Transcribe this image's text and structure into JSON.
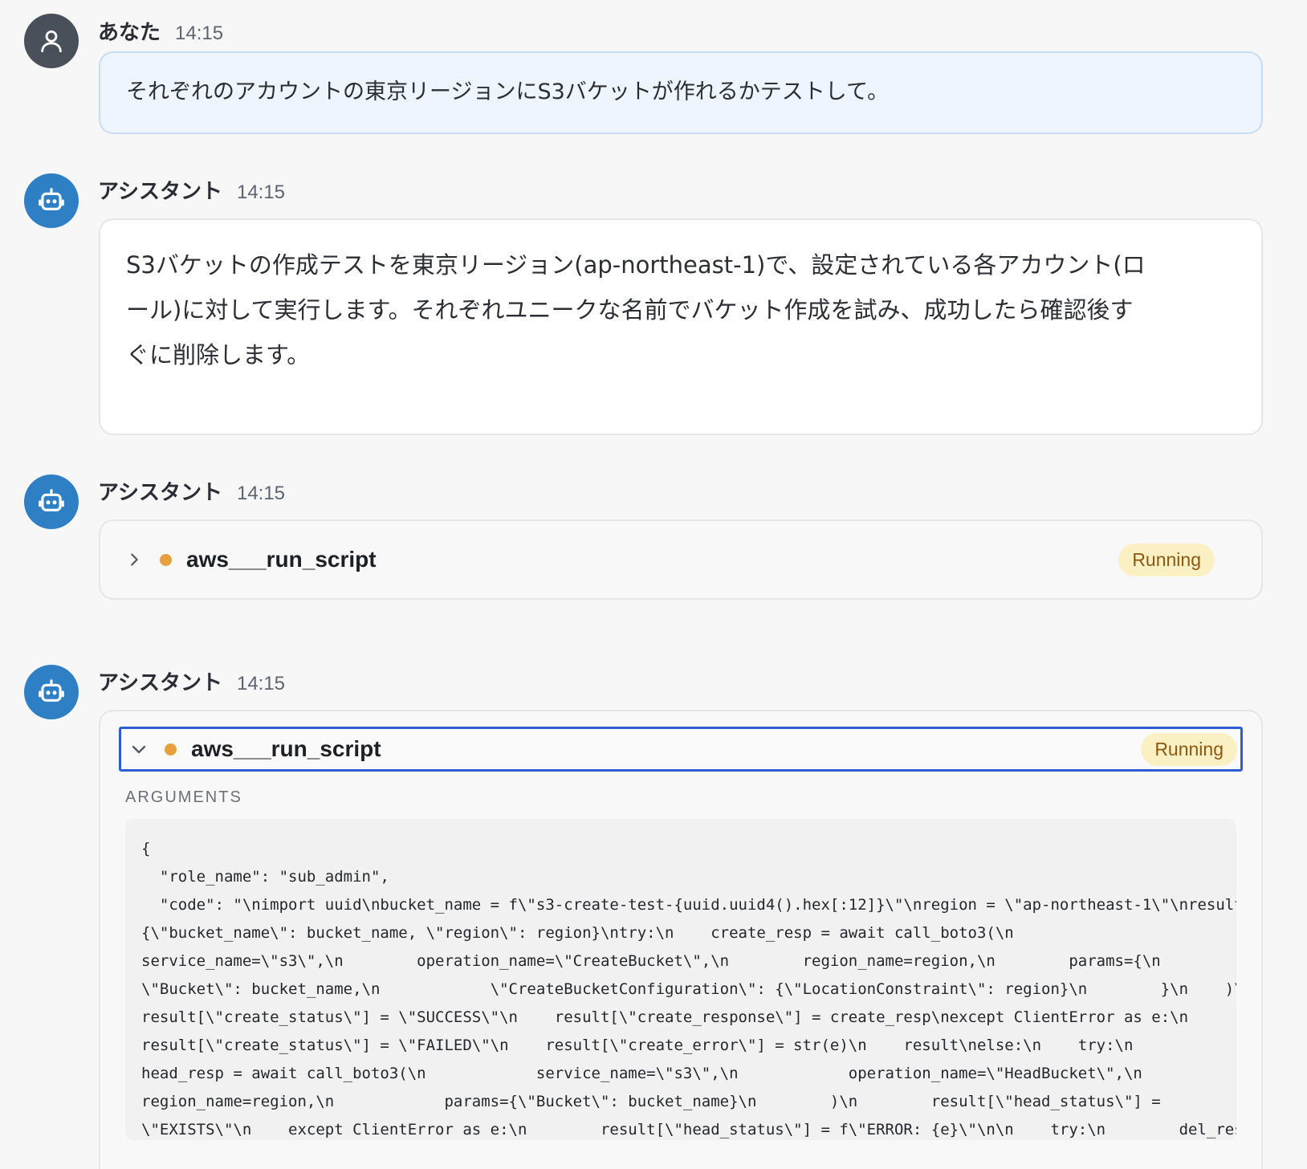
{
  "messages": [
    {
      "role": "user",
      "author": "あなた",
      "time": "14:15",
      "text": "それぞれのアカウントの東京リージョンにS3バケットが作れるかテストして。"
    },
    {
      "role": "assistant",
      "author": "アシスタント",
      "time": "14:15",
      "text_lines": [
        "S3バケットの作成テストを東京リージョン(ap-northeast-1)で、設定されている各アカウント(ロ",
        "ール)に対して実行します。それぞれユニークな名前でバケット作成を試み、成功したら確認後す",
        "ぐに削除します。"
      ]
    },
    {
      "role": "assistant",
      "author": "アシスタント",
      "time": "14:15",
      "tool": {
        "name": "aws___run_script",
        "status": "Running",
        "expanded": false
      }
    },
    {
      "role": "assistant",
      "author": "アシスタント",
      "time": "14:15",
      "tool": {
        "name": "aws___run_script",
        "status": "Running",
        "expanded": true,
        "arguments_label": "ARGUMENTS",
        "arguments_lines": [
          "{",
          "  \"role_name\": \"sub_admin\",",
          "  \"code\": \"\\nimport uuid\\nbucket_name = f\\\"s3-create-test-{uuid.uuid4().hex[:12]}\\\"\\nregion = \\\"ap-northeast-1\\\"\\nresult =",
          "{\\\"bucket_name\\\": bucket_name, \\\"region\\\": region}\\ntry:\\n    create_resp = await call_boto3(\\n",
          "service_name=\\\"s3\\\",\\n        operation_name=\\\"CreateBucket\\\",\\n        region_name=region,\\n        params={\\n",
          "\\\"Bucket\\\": bucket_name,\\n            \\\"CreateBucketConfiguration\\\": {\\\"LocationConstraint\\\": region}\\n        }\\n    )\\n",
          "result[\\\"create_status\\\"] = \\\"SUCCESS\\\"\\n    result[\\\"create_response\\\"] = create_resp\\nexcept ClientError as e:\\n",
          "result[\\\"create_status\\\"] = \\\"FAILED\\\"\\n    result[\\\"create_error\\\"] = str(e)\\n    result\\nelse:\\n    try:\\n",
          "head_resp = await call_boto3(\\n            service_name=\\\"s3\\\",\\n            operation_name=\\\"HeadBucket\\\",\\n",
          "region_name=region,\\n            params={\\\"Bucket\\\": bucket_name}\\n        )\\n        result[\\\"head_status\\\"] =",
          "\\\"EXISTS\\\"\\n    except ClientError as e:\\n        result[\\\"head_status\\\"] = f\\\"ERROR: {e}\\\"\\n\\n    try:\\n        del_resp"
        ]
      }
    }
  ],
  "icons": {
    "user_avatar": "user-icon",
    "assistant_avatar": "robot-icon",
    "collapsed": "chevron-right-icon",
    "expanded": "chevron-down-icon",
    "status_dot": "status-dot-icon"
  },
  "colors": {
    "user_avatar_bg": "#4a5059",
    "assistant_avatar_bg": "#2f7fc4",
    "user_bubble_bg": "#eef5fe",
    "running_badge_bg": "#fbefc4",
    "running_badge_text": "#8a5a12",
    "status_dot": "#e8a03c",
    "focus_outline": "#2f5bd3"
  }
}
